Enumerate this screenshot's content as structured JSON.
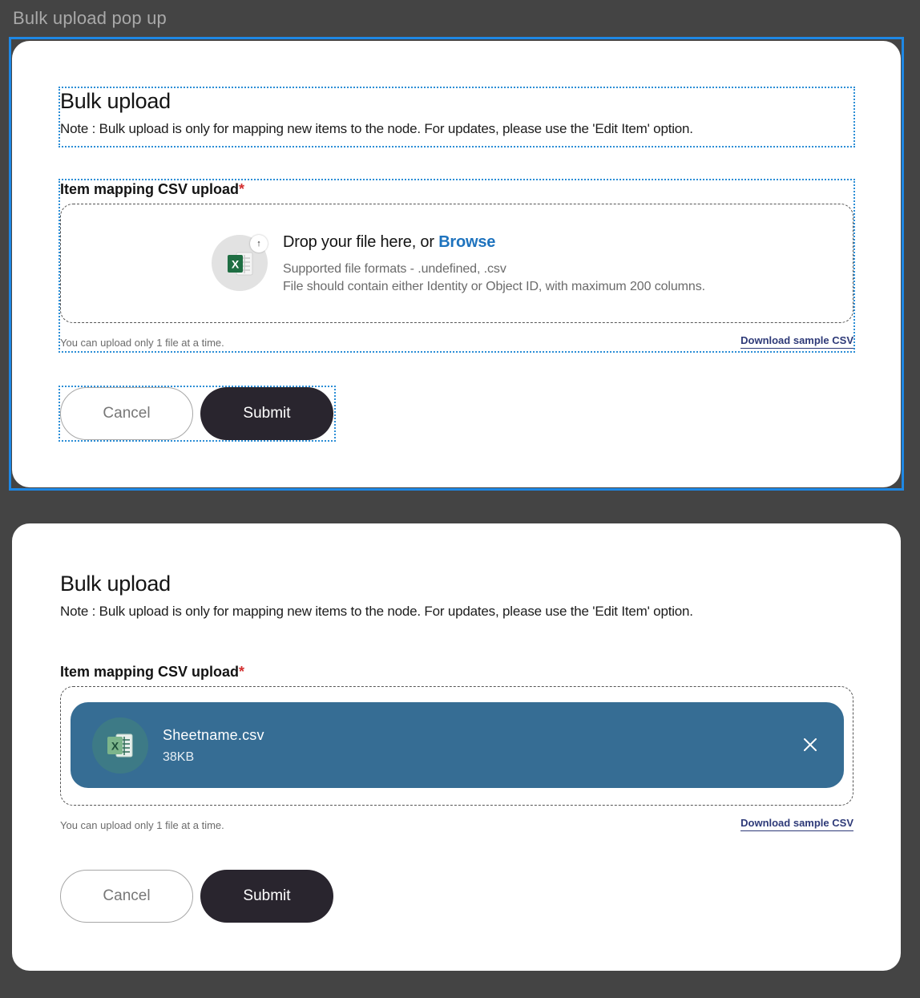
{
  "frame_label": "Bulk upload pop up",
  "colors": {
    "background": "#444444",
    "selection": "#1e88e5",
    "browse": "#1e73be",
    "required": "#d32f2f",
    "submit_bg": "#29252e",
    "file_chip_bg": "#366d94",
    "link": "#2e3a78"
  },
  "modal_empty": {
    "title": "Bulk upload",
    "note": "Note : Bulk upload is only for mapping new items to the node. For updates, please use the 'Edit Item' option.",
    "field_label": "Item mapping CSV upload",
    "required_mark": "*",
    "dropzone": {
      "icon": "excel-icon",
      "badge_icon": "upload-arrow-icon",
      "badge_symbol": "↑",
      "drop_prefix": "Drop your file here, or ",
      "browse_label": "Browse",
      "formats": "Supported file formats - .undefined, .csv",
      "constraint": "File should contain either Identity or Object ID, with maximum 200 columns."
    },
    "limit_hint": "You can upload only 1 file at a time.",
    "sample_link": "Download sample CSV",
    "cancel_label": "Cancel",
    "submit_label": "Submit"
  },
  "modal_uploaded": {
    "title": "Bulk upload",
    "note": "Note : Bulk upload is only for mapping new items to the node. For updates, please use the 'Edit Item' option.",
    "field_label": "Item mapping CSV upload",
    "required_mark": "*",
    "file": {
      "icon": "excel-icon",
      "name": "Sheetname.csv",
      "size": "38KB",
      "remove_icon": "close-icon"
    },
    "limit_hint": "You can upload only 1 file at a time.",
    "sample_link": "Download sample CSV",
    "cancel_label": "Cancel",
    "submit_label": "Submit"
  }
}
